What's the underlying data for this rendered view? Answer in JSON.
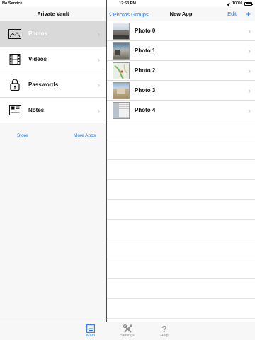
{
  "status_bar": {
    "carrier": "No Service",
    "time": "12:53 PM",
    "battery": "100%"
  },
  "left_pane": {
    "title": "Private Vault",
    "items": [
      {
        "label": "Photos",
        "icon": "photo-icon"
      },
      {
        "label": "Videos",
        "icon": "film-icon"
      },
      {
        "label": "Passwords",
        "icon": "lock-icon"
      },
      {
        "label": "Notes",
        "icon": "notes-icon"
      }
    ],
    "selected_item": "Photos",
    "links": {
      "store": "Store",
      "more_apps": "More Apps"
    }
  },
  "right_pane": {
    "back_label": "Photos Groups",
    "title": "New App",
    "edit_label": "Edit",
    "add_label": "+",
    "photos": [
      {
        "label": "Photo 0"
      },
      {
        "label": "Photo 1"
      },
      {
        "label": "Photo 2"
      },
      {
        "label": "Photo 3"
      },
      {
        "label": "Photo 4"
      }
    ]
  },
  "tab_bar": {
    "tabs": [
      {
        "label": "Main",
        "icon": "list-icon",
        "active": true
      },
      {
        "label": "Settings",
        "icon": "tools-icon",
        "active": false
      },
      {
        "label": "Help",
        "icon": "question-icon",
        "active": false
      }
    ]
  },
  "colors": {
    "accent": "#2a7ae2",
    "selected_row": "#d9d9d9",
    "divider": "#4a4a4a"
  }
}
